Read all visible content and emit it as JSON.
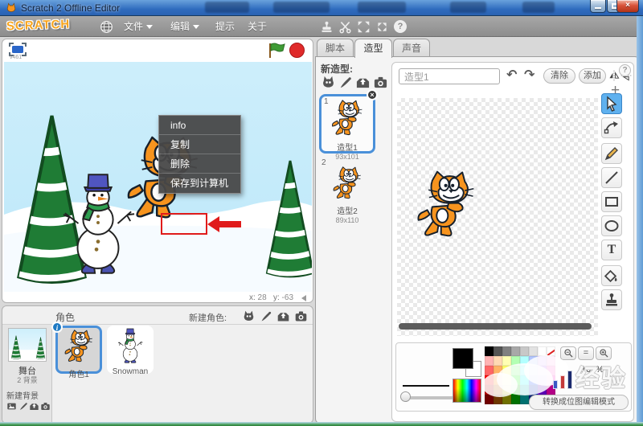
{
  "titlebar": {
    "title": "Scratch 2 Offline Editor"
  },
  "menubar": {
    "logo": "SCRATCH",
    "file": "文件",
    "edit": "编辑",
    "tips": "提示",
    "about": "关于"
  },
  "stage": {
    "version": "v461",
    "coords_x_label": "x:",
    "coords_x": "28",
    "coords_y_label": "y:",
    "coords_y": "-63"
  },
  "context_menu": {
    "info": "info",
    "duplicate": "复制",
    "delete": "删除",
    "save": "保存到计算机"
  },
  "sprites_panel": {
    "title": "角色",
    "new_sprite_label": "新建角色:",
    "stage_title": "舞台",
    "stage_subtitle": "2 背景",
    "new_backdrop_label": "新建背景",
    "sprite1_name": "角色1",
    "sprite2_name": "Snowman",
    "info_badge": "i"
  },
  "tabs": {
    "scripts": "脚本",
    "costumes": "造型",
    "sounds": "声音"
  },
  "costumes_panel": {
    "new_costume_label": "新造型:",
    "costume1_index": "1",
    "costume1_name": "造型1",
    "costume1_size": "93x101",
    "costume2_index": "2",
    "costume2_name": "造型2",
    "costume2_size": "89x110",
    "delete_badge": "×"
  },
  "paint_editor": {
    "name_value": "造型1",
    "undo_glyph": "↶",
    "redo_glyph": "↷",
    "clear_label": "清除",
    "add_label": "添加",
    "center_glyph": "+",
    "help_glyph": "?",
    "text_tool_glyph": "T",
    "zoom_equal_label": "=",
    "zoom_level": "100%",
    "convert_label": "转换成位图编辑模式",
    "palette_rows": [
      [
        "#000000",
        "#545454",
        "#808080",
        "#a8a8a8",
        "#c8c8c8",
        "#e2e2e2",
        "#ffffff",
        "transparent"
      ],
      [
        "#ffb3b3",
        "#ffd9b3",
        "#ffffb3",
        "#b3ffb3",
        "#b3ffff",
        "#b3c6ff",
        "#d9b3ff",
        "#ffb3e6"
      ],
      [
        "#ff6666",
        "#ffb366",
        "#ffff66",
        "#66ff66",
        "#66ffff",
        "#668cff",
        "#b366ff",
        "#ff66cc"
      ],
      [
        "#ff0000",
        "#ff8000",
        "#ffff00",
        "#00ff00",
        "#00ffff",
        "#0040ff",
        "#8000ff",
        "#ff00bf"
      ],
      [
        "#b30000",
        "#b35900",
        "#b3b300",
        "#00b300",
        "#00b3b3",
        "#002db3",
        "#5900b3",
        "#b30086"
      ],
      [
        "#700000",
        "#703800",
        "#707000",
        "#007000",
        "#007070",
        "#001c70",
        "#380070",
        "#700054"
      ]
    ]
  },
  "window_controls": {
    "minimize": "",
    "maximize": "",
    "close": "×"
  },
  "watermark": {
    "text": "经验"
  },
  "colors": {
    "accent_blue": "#4a90d9",
    "flag_green": "#3f9c35",
    "stop_red": "#e02a2a",
    "titlebar_blue": "#2f6cbe",
    "annotation_red": "#e01b1b"
  }
}
